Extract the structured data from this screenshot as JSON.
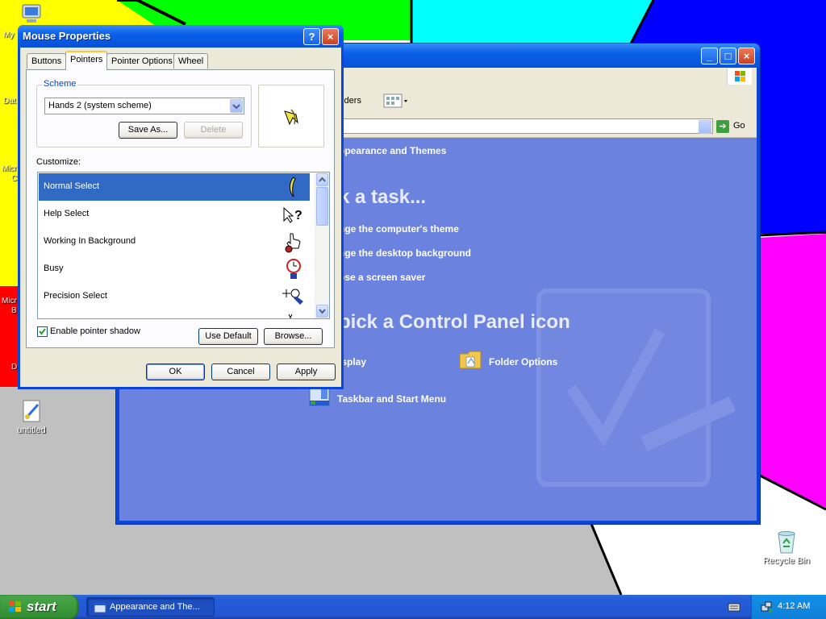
{
  "desktop": {
    "icons": {
      "untitled": "untitled",
      "recycle_bin": "Recycle Bin",
      "partial_my": "My",
      "partial_dat": "Dat",
      "partial_micro": "Micro",
      "partial_c": "C",
      "partial_micr": "Micr",
      "partial_b": "B",
      "partial_d": "D"
    }
  },
  "control_panel": {
    "toolbar_folders": "olders",
    "go_label": "Go",
    "location_title": "ppearance and Themes",
    "pick_task_heading": "k a task...",
    "tasks": [
      "nge the computer's theme",
      "nge the desktop background",
      "ose a screen saver"
    ],
    "or_pick_heading": "pick a Control Panel icon",
    "icons": [
      "isplay",
      "Folder Options",
      "Taskbar and Start Menu"
    ]
  },
  "mouse_dialog": {
    "title": "Mouse Properties",
    "tabs": [
      "Buttons",
      "Pointers",
      "Pointer Options",
      "Wheel"
    ],
    "active_tab": "Pointers",
    "scheme_group_label": "Scheme",
    "scheme_value": "Hands 2 (system scheme)",
    "save_as_label": "Save As...",
    "delete_label": "Delete",
    "customize_label": "Customize:",
    "cursor_items": [
      {
        "name": "Normal Select",
        "selected": true
      },
      {
        "name": "Help Select",
        "selected": false
      },
      {
        "name": "Working In Background",
        "selected": false
      },
      {
        "name": "Busy",
        "selected": false
      },
      {
        "name": "Precision Select",
        "selected": false
      }
    ],
    "enable_shadow_label": "Enable pointer shadow",
    "enable_shadow_checked": true,
    "use_default_label": "Use Default",
    "browse_label": "Browse...",
    "ok_label": "OK",
    "cancel_label": "Cancel",
    "apply_label": "Apply",
    "help_btn": "?",
    "close_btn": "×"
  },
  "taskbar": {
    "start_label": "start",
    "task_item_label": "Appearance and The...",
    "clock": "4:12 AM"
  },
  "colors": {
    "selection": "#316ac5",
    "titlebar": "#0a5fe8",
    "cp_content": "#6b82de"
  }
}
